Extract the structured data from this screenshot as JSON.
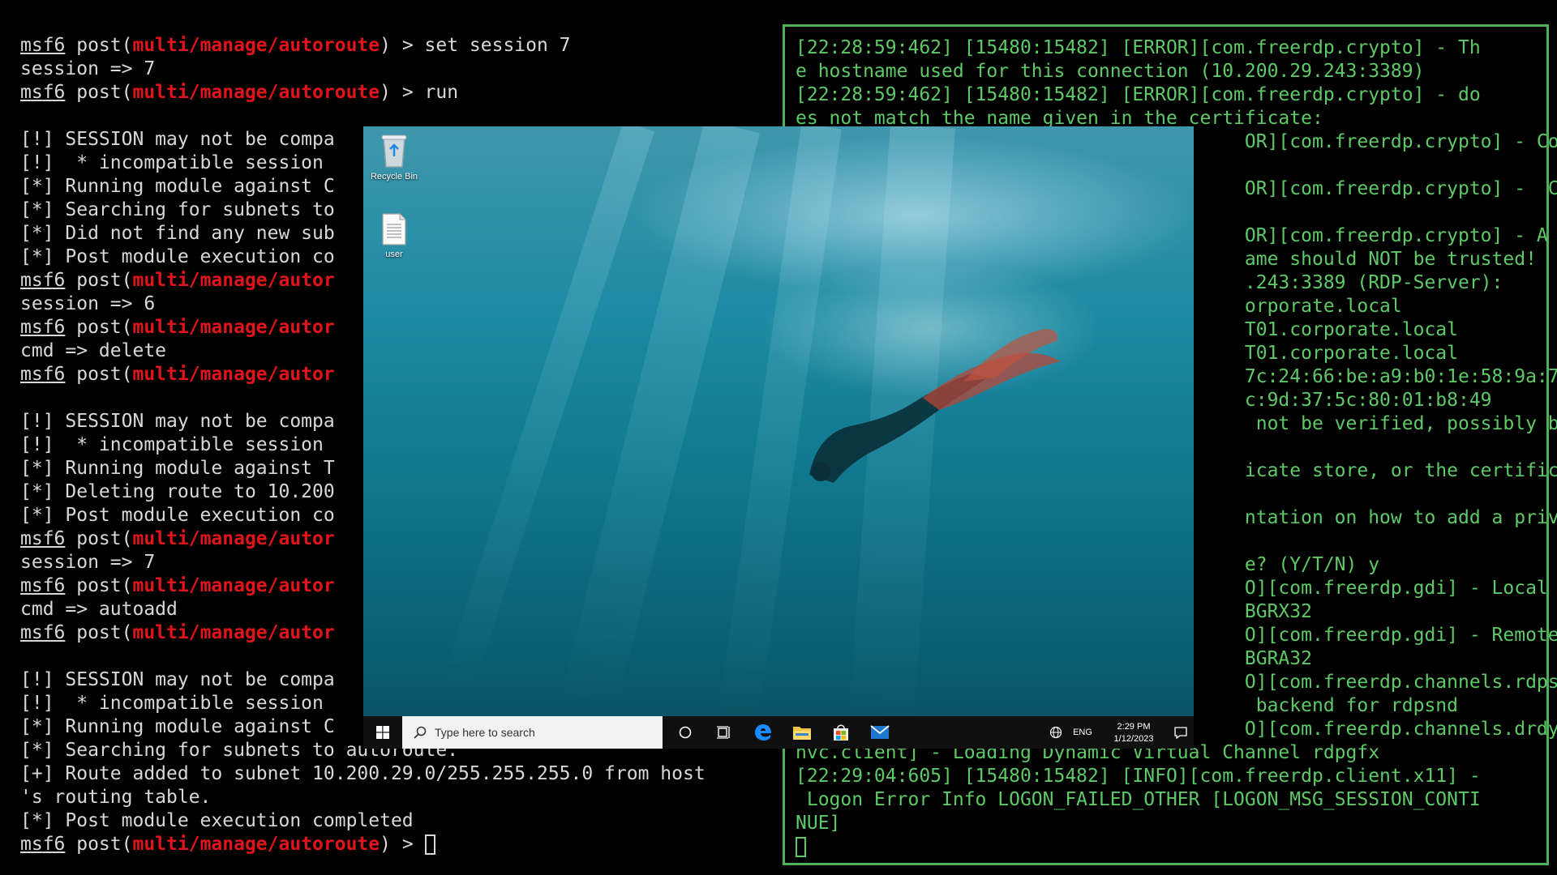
{
  "left_terminal": {
    "prompt_prefix": "msf6",
    "lines": [
      {
        "kind": "prompt",
        "pre": " post(",
        "module": "multi/manage/autoroute",
        "post": ") > set session 7"
      },
      {
        "kind": "text",
        "text": "session => 7"
      },
      {
        "kind": "prompt",
        "pre": " post(",
        "module": "multi/manage/autoroute",
        "post": ") > run"
      },
      {
        "kind": "blank",
        "text": ""
      },
      {
        "kind": "text",
        "text": "[!] SESSION may not be compa"
      },
      {
        "kind": "text",
        "text": "[!]  * incompatible session"
      },
      {
        "kind": "text",
        "text": "[*] Running module against C"
      },
      {
        "kind": "text",
        "text": "[*] Searching for subnets to"
      },
      {
        "kind": "text",
        "text": "[*] Did not find any new sub"
      },
      {
        "kind": "text",
        "text": "[*] Post module execution co"
      },
      {
        "kind": "prompt",
        "pre": " post(",
        "module": "multi/manage/autor",
        "post": ""
      },
      {
        "kind": "text",
        "text": "session => 6"
      },
      {
        "kind": "prompt",
        "pre": " post(",
        "module": "multi/manage/autor",
        "post": ""
      },
      {
        "kind": "text",
        "text": "cmd => delete"
      },
      {
        "kind": "prompt",
        "pre": " post(",
        "module": "multi/manage/autor",
        "post": ""
      },
      {
        "kind": "blank",
        "text": ""
      },
      {
        "kind": "text",
        "text": "[!] SESSION may not be compa"
      },
      {
        "kind": "text",
        "text": "[!]  * incompatible session"
      },
      {
        "kind": "text",
        "text": "[*] Running module against T"
      },
      {
        "kind": "text",
        "text": "[*] Deleting route to 10.200"
      },
      {
        "kind": "text",
        "text": "[*] Post module execution co"
      },
      {
        "kind": "prompt",
        "pre": " post(",
        "module": "multi/manage/autor",
        "post": ""
      },
      {
        "kind": "text",
        "text": "session => 7"
      },
      {
        "kind": "prompt",
        "pre": " post(",
        "module": "multi/manage/autor",
        "post": ""
      },
      {
        "kind": "text",
        "text": "cmd => autoadd"
      },
      {
        "kind": "prompt",
        "pre": " post(",
        "module": "multi/manage/autor",
        "post": ""
      },
      {
        "kind": "blank",
        "text": ""
      },
      {
        "kind": "text",
        "text": "[!] SESSION may not be compa"
      },
      {
        "kind": "text",
        "text": "[!]  * incompatible session"
      },
      {
        "kind": "text",
        "text": "[*] Running module against C"
      },
      {
        "kind": "text",
        "text": "[*] Searching for subnets to autoroute."
      },
      {
        "kind": "text",
        "text": "[+] Route added to subnet 10.200.29.0/255.255.255.0 from host"
      },
      {
        "kind": "text",
        "text": "'s routing table."
      },
      {
        "kind": "text",
        "text": "[*] Post module execution completed"
      },
      {
        "kind": "prompt",
        "pre": " post(",
        "module": "multi/manage/autoroute",
        "post": ") > ",
        "cursor": true
      }
    ]
  },
  "right_terminal": {
    "lines": [
      "[22:28:59:462] [15480:15482] [ERROR][com.freerdp.crypto] - Th",
      "e hostname used for this connection (10.200.29.243:3389)",
      "[22:28:59:462] [15480:15482] [ERROR][com.freerdp.crypto] - do",
      "es not match the name given in the certificate:",
      "                                        OR][com.freerdp.crypto] - Co",
      "",
      "                                        OR][com.freerdp.crypto] -  C",
      "",
      "                                        OR][com.freerdp.crypto] - A",
      "                                        ame should NOT be trusted!",
      "                                        .243:3389 (RDP-Server):",
      "                                        orporate.local",
      "                                        T01.corporate.local",
      "                                        T01.corporate.local",
      "                                        7c:24:66:be:a9:b0:1e:58:9a:7",
      "                                        c:9d:37:5c:80:01:b8:49",
      "                                         not be verified, possibly b",
      "",
      "                                        icate store, or the certific",
      "",
      "                                        ntation on how to add a priv",
      "",
      "                                        e? (Y/T/N) y",
      "                                        O][com.freerdp.gdi] - Local",
      "                                        BGRX32",
      "                                        O][com.freerdp.gdi] - Remote",
      "                                        BGRA32",
      "                                        O][com.freerdp.channels.rdps",
      "                                         backend for rdpsnd",
      "                                        O][com.freerdp.channels.drdy",
      "nvc.client] - Loading Dynamic Virtual Channel rdpgfx",
      "[22:29:04:605] [15480:15482] [INFO][com.freerdp.client.x11] -",
      " Logon Error Info LOGON_FAILED_OTHER [LOGON_MSG_SESSION_CONTI",
      "NUE]"
    ]
  },
  "rdp_window": {
    "desktop_icons": [
      {
        "label": "Recycle Bin",
        "icon": "recycle-bin-icon"
      },
      {
        "label": "user",
        "icon": "text-file-icon"
      }
    ],
    "taskbar": {
      "search_placeholder": "Type here to search",
      "lang": "ENG",
      "time": "2:29 PM",
      "date": "1/12/2023"
    }
  },
  "colors": {
    "module_red": "#e0141a",
    "rdp_green": "#5ec967",
    "frame_green": "#4fb157"
  }
}
